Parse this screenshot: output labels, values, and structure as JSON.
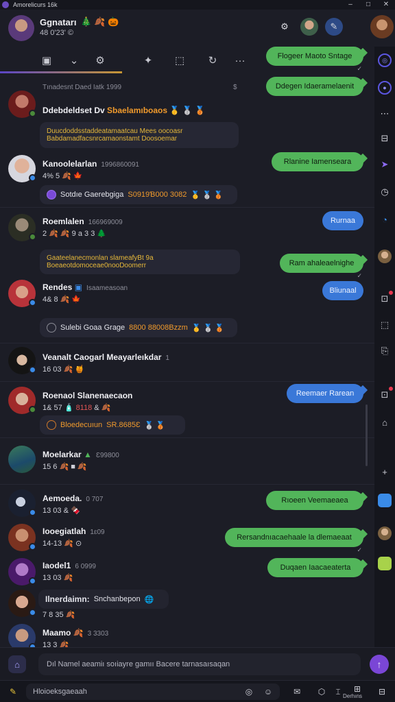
{
  "window": {
    "title": "Amorelicurs 16k",
    "controls": [
      "–",
      "□",
      "✕"
    ]
  },
  "header": {
    "title": "Ggnatarı",
    "title_emojis": "🎄 🍂 🎃",
    "subtitle": "48 0'23' ©"
  },
  "tabs": [
    {
      "name": "tab-chat",
      "icon": "▣"
    },
    {
      "name": "tab-dropdown",
      "icon": "⌄"
    },
    {
      "name": "tab-gear",
      "icon": "⚙"
    },
    {
      "name": "tab-puzzle",
      "icon": "✦"
    },
    {
      "name": "tab-expand",
      "icon": "⬚"
    },
    {
      "name": "tab-refresh",
      "icon": "↻"
    },
    {
      "name": "tab-more",
      "icon": "···"
    }
  ],
  "colors": {
    "green": "#52b55a",
    "blue": "#3a78d8",
    "accent": "#7a46d6",
    "background": "#1c1d26"
  },
  "chat": {
    "date_separator": "Tınadesnt Daed Iatk 1999",
    "date_separator_right": "$",
    "messages": [
      {
        "name": "Ddebdeldset Dv",
        "name_accent": "Sbaelamıboaos",
        "card_line1": "Duucdoddsstaddeatamaatcau Mees oocoasr",
        "card_line2": "Babdamadfacsnrcamaonstamt Doosoemar"
      },
      {
        "name": "Kanoolelarlan",
        "time": "1996860091",
        "meta": "4% 5 🍂 🍁",
        "card_text": "Sotdıe Gaerebgiga",
        "card_accent": "S0919Ɓ000 3082"
      },
      {
        "name": "Roemlalen",
        "time": "166969009",
        "meta": "2 🍂 🍂 9 a 3 3 🌲",
        "card_line1": "Gaateelanecmonlan slameafyBt 9a",
        "card_line2": "Boeaeotdomoceae0nooDoomerr"
      },
      {
        "name": "Rendes",
        "time": "Isaameasoan",
        "meta": "4& 8 🍂 🍁",
        "card_text": "Sulebi Goaa Grage",
        "card_accent": "8800 88008Bzzm"
      },
      {
        "name": "Veanalt Caogarl Meayarleıkdar",
        "time": "1",
        "meta": "16 03 🍂 🍯"
      },
      {
        "name": "Roenaol Slanenaecaon",
        "meta": "1& 57 🧴",
        "meta_red": "8118",
        "meta_tail": "& 🍂",
        "card_text": "Bloedecuıun",
        "card_accent": "SR.8685Ɛ"
      },
      {
        "name": "Moelarkar",
        "time": "Ɛ99800",
        "meta": "15 6 🍂 ■ 🍂"
      },
      {
        "name": "Aemoeda.",
        "time": "0 707",
        "meta": "13 03 & 🍫"
      },
      {
        "name": "Iooegiatlah",
        "time": "1ɛ09",
        "meta": "14-13 🍂 ⊙"
      },
      {
        "name": "Iaodel1",
        "time": "6 0999",
        "meta": "13 03 🍂"
      },
      {
        "name": "Ilnerdaimn:",
        "name_tail": "Snchanbepon",
        "meta": "7 8 35 🍂"
      },
      {
        "name": "Maamo",
        "time": "3 3303",
        "meta": "13 3 🍂"
      }
    ],
    "bubbles": [
      {
        "text": "Flogeer Maoto Sntage",
        "style": "green"
      },
      {
        "text": "Ddegen Idaeramelaenit",
        "style": "green"
      },
      {
        "text": "Rlanine Iamenseara",
        "style": "green"
      },
      {
        "text": "Rurnaa",
        "style": "blue"
      },
      {
        "text": "Ram ahaleaelnighe",
        "style": "green"
      },
      {
        "text": "Bliunaal",
        "style": "blue"
      },
      {
        "text": "Reemaer Rarean",
        "style": "blue"
      },
      {
        "text": "Rıoeen Veemaeaea",
        "style": "green"
      },
      {
        "text": "Rersandnıacaehaale la dlemaeaat",
        "style": "green"
      },
      {
        "text": "Duqaen Iaacaeaterta",
        "style": "green"
      }
    ]
  },
  "compose": {
    "placeholder": "Dıl Namel aeamiı soıiayre gamıı Bacere tarnasaısaqan",
    "send_icon": "↑",
    "left_icon": "⌂"
  },
  "bottombar": {
    "search_text": "Hloioeksgaeaah",
    "label": "Derhıns"
  }
}
